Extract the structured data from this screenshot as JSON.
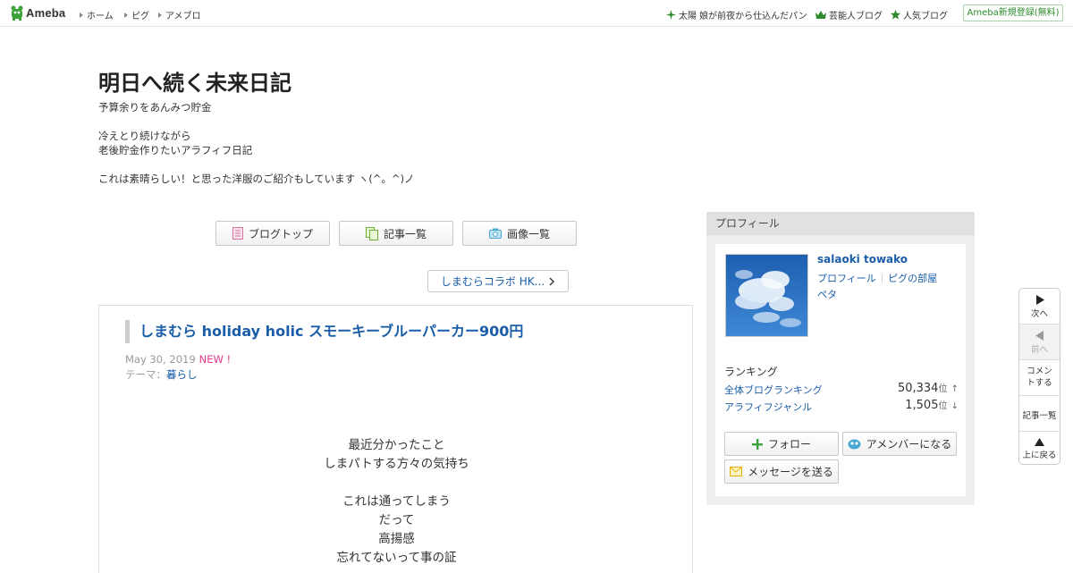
{
  "topbar": {
    "logo_text": "Ameba",
    "nav": [
      "ホーム",
      "ピグ",
      "アメブロ"
    ],
    "trend": "太陽 娘が前夜から仕込んだパン",
    "celebrity": "芸能人ブログ",
    "popular": "人気ブログ",
    "signup": "Ameba新規登録(無料)"
  },
  "blog": {
    "title": "明日へ続く未来日記",
    "description": [
      "予算余りをあんみつ貯金",
      "冷えとり続けながら",
      "老後貯金作りたいアラフィフ日記",
      "これは素晴らしい！と思った洋服のご紹介もしています ヽ(^。^)ノ"
    ]
  },
  "nav_buttons": {
    "top": "ブログトップ",
    "list": "記事一覧",
    "images": "画像一覧"
  },
  "series_button": "しまむらコラボ HK...",
  "article": {
    "title": "しまむら holiday holic スモーキーブルーパーカー900円",
    "date": "May 30, 2019",
    "new_label": "NEW !",
    "theme_label": "テーマ：",
    "theme": "暮らし",
    "body": [
      "最近分かったこと",
      "しまパトする方々の気持ち",
      "これは通ってしまう",
      "だって",
      "高揚感",
      "忘れてないって事の証"
    ]
  },
  "profile": {
    "header": "プロフィール",
    "name": "salaoki towako",
    "link_profile": "プロフィール",
    "link_pigg": "ピグの部屋",
    "link_peta": "ペタ",
    "ranking_label": "ランキング",
    "rankings": [
      {
        "name": "全体ブログランキング",
        "value": "50,334",
        "unit": "位",
        "trend": "↑"
      },
      {
        "name": "アラフィフジャンル",
        "value": "1,505",
        "unit": "位",
        "trend": "↓"
      }
    ],
    "follow": "フォロー",
    "member": "アメンバーになる",
    "message": "メッセージを送る"
  },
  "sidenav": {
    "next": "次へ",
    "prev": "前へ",
    "comment": "コメントする",
    "list": "記事一覧",
    "top": "上に戻る"
  },
  "colors": {
    "link": "#1a5da8",
    "new": "#e0378a",
    "ameba_green": "#2d8a2d"
  }
}
